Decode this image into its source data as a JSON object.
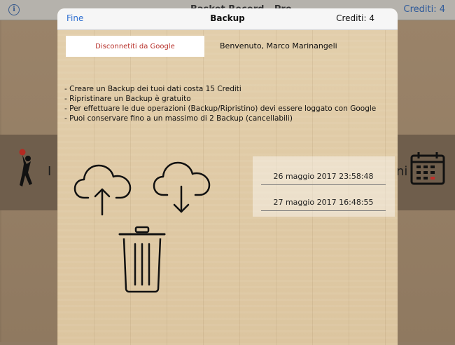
{
  "background": {
    "title": "Basket Record - Pro",
    "credits_label": "Crediti: 4"
  },
  "modal": {
    "done_label": "Fine",
    "title": "Backup",
    "credits_label": "Crediti: 4",
    "disconnect_label": "Disconnetiti da Google",
    "welcome_text": "Benvenuto, Marco Marinangeli",
    "info_lines": [
      "- Creare un Backup dei tuoi dati costa 15 Crediti",
      "- Ripristinare un Backup è gratuito",
      "- Per effettuare le due operazioni (Backup/Ripristino) devi essere loggato con Google",
      "- Puoi conservare fino a un massimo di 2 Backup (cancellabili)"
    ],
    "backups": [
      "26 maggio 2017 23:58:48",
      "27 maggio 2017 16:48:55"
    ],
    "icons": {
      "upload": "cloud-upload-icon",
      "download": "cloud-download-icon",
      "delete": "trash-icon"
    }
  },
  "colors": {
    "accent": "#2f6fd1",
    "destructive": "#b8322c"
  }
}
